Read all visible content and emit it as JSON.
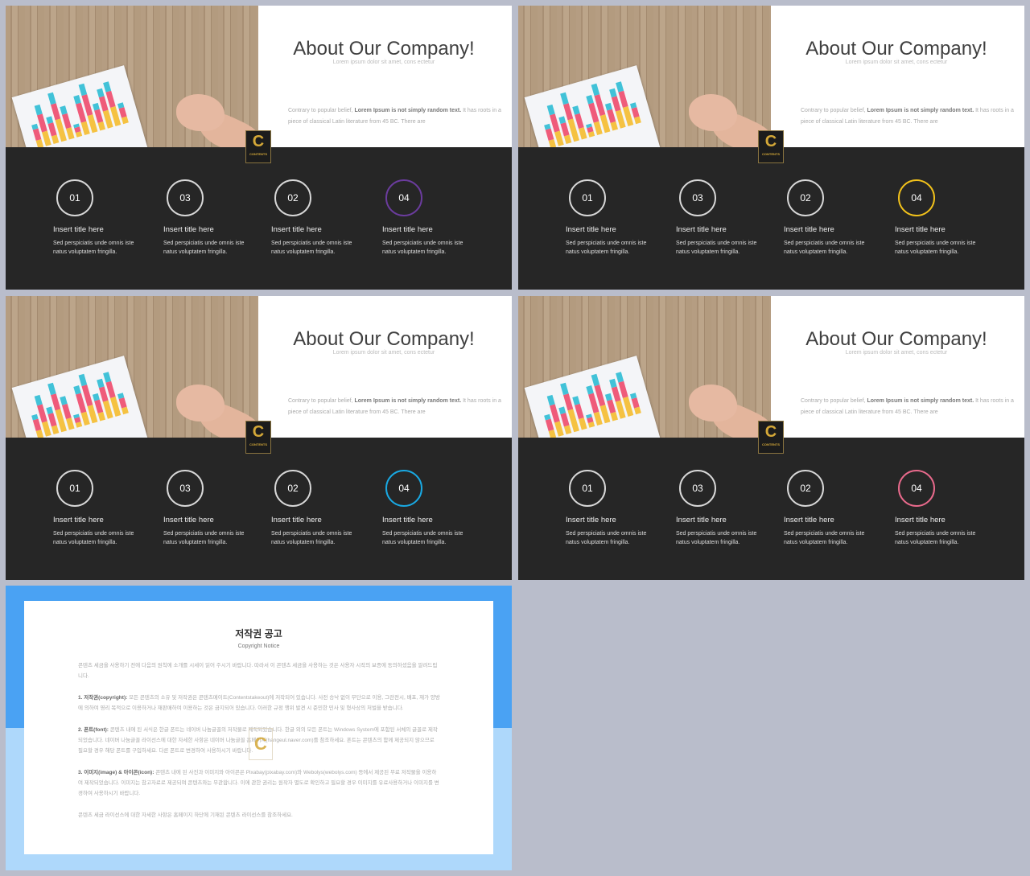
{
  "slides": [
    {
      "accent": "#6b3c9e"
    },
    {
      "accent": "#f2c21b"
    },
    {
      "accent": "#19a9e3"
    },
    {
      "accent": "#e96a8c"
    }
  ],
  "slide_content": {
    "title": "About Our Company!",
    "subtitle": "Lorem ipsum dolor sit amet, cons ectetur",
    "body_pre": "Contrary to popular belief, ",
    "body_bold": "Lorem Ipsum is not simply random text.",
    "body_post": " It has roots in a piece of classical Latin literature from 45 BC. There are",
    "logo_letter": "C",
    "logo_text": "CONTENTS",
    "items": [
      {
        "number": "01",
        "title": "Insert title here",
        "desc": "Sed perspiciatis unde omnis iste natus voluptatem fringilla."
      },
      {
        "number": "03",
        "title": "Insert title here",
        "desc": "Sed perspiciatis unde omnis iste natus voluptatem fringilla."
      },
      {
        "number": "02",
        "title": "Insert title here",
        "desc": "Sed perspiciatis unde omnis iste natus voluptatem fringilla."
      },
      {
        "number": "04",
        "title": "Insert title here",
        "desc": "Sed perspiciatis unde omnis iste natus voluptatem fringilla."
      }
    ]
  },
  "notice": {
    "title": "저작권 공고",
    "subtitle": "Copyright Notice",
    "intro": "콘텐츠 세금을 사용하기 전에 다음의 원칙에 소개를 시세이 읽어 주시기 바랍니다. 따라서 이 콘텐츠 세금을 사용하는 것은 사용자 시작의 보증에 동의하셨음을 알려드립니다.",
    "p1_label": "1. 저작권(copyright): ",
    "p1": "모든 콘텐츠의 소유 및 저작권은 콘텐츠메이트(Contentstakeout)에 저작되어 있습니다. 사전 승낙 없이 무단으로 이용, 그란전시, 배포, 재가 양방에 의하여 영리 목적으로 이용하거나 재판매하여 이용하는 것은 금지되어 있습니다. 이러한 규정 행위 발견 시 준민한 민사 및 형사상의 처벌을 받습니다.",
    "p2_label": "2. 폰트(font): ",
    "p2": "콘텐츠 내에 된 서식은 한글 폰트는 네이버 나눔글꼴의 저작물로 제작되었습니다. 한글 외의 모든 폰트는 Windows System에 포함된 서체의 글꼴로 제작되었습니다. 네이버 나눔글꼴 라이선스에 대한 자세한 사항은 네이버 나눔글꼴 홈페이지(hangeul.naver.com)를 참조하세요. 폰트는 콘텐츠의 함께 제공되지 않으므로 필요할 경우 해당 폰트를 구입하세요. 다른 폰트로 변경하여 사용하시기 바랍니다.",
    "p3_label": "3. 이미지(image) & 아이콘(icon): ",
    "p3": "콘텐츠 내에 된 사진과 이미지와 아이콘은 Pixabay(pixabay.com)와 Webolys(webolys.com) 등에서 제공된 무료 저작물을 이용하여 제작되었습니다. 이미지는 참고자료로 제공되며 콘텐츠와는 무관합니다. 이에 관한 권리는 원작자 별도로 확인하고 필요할 경우 이미지를 유료사용하거나 이미지를 변경하여 사용하시기 바랍니다.",
    "outro": "콘텐츠 세금 라이선스에 대한 자세한 사항은 홈페이지 하단에 기재된 콘텐츠 라이선스를 참조하세요.",
    "logo_letter": "C"
  }
}
